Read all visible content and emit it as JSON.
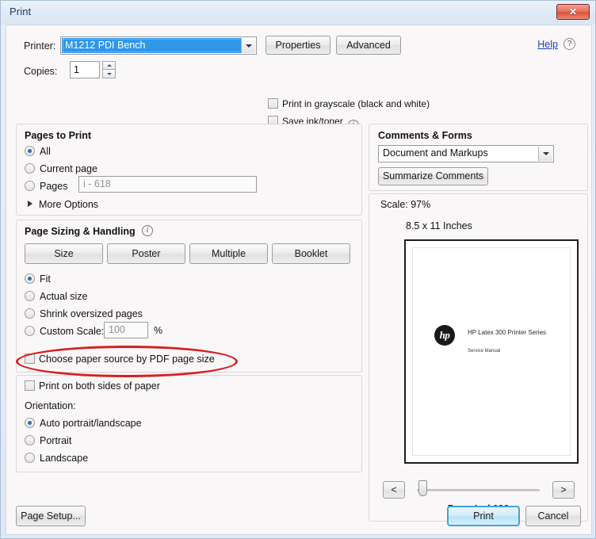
{
  "window": {
    "title": "Print",
    "close_label": "✕"
  },
  "printer": {
    "label": "Printer:",
    "selected": "M1212 PDI Bench",
    "properties_label": "Properties",
    "advanced_label": "Advanced",
    "help_label": "Help",
    "help_icon": "?",
    "copies_label": "Copies:",
    "copies_value": "1",
    "grayscale_label": "Print in grayscale (black and white)",
    "saveink_label": "Save ink/toner",
    "info_icon": "i"
  },
  "pages_to_print": {
    "header": "Pages to Print",
    "options": [
      {
        "label": "All",
        "selected": true
      },
      {
        "label": "Current page",
        "selected": false
      },
      {
        "label": "Pages",
        "selected": false
      }
    ],
    "pages_placeholder": "i - 618",
    "more_options_label": "More Options"
  },
  "page_sizing": {
    "header": "Page Sizing & Handling",
    "info_icon": "i",
    "buttons": [
      {
        "label": "Size"
      },
      {
        "label": "Poster"
      },
      {
        "label": "Multiple"
      },
      {
        "label": "Booklet"
      }
    ],
    "options": [
      {
        "label": "Fit",
        "selected": true
      },
      {
        "label": "Actual size",
        "selected": false
      },
      {
        "label": "Shrink oversized pages",
        "selected": false
      },
      {
        "label": "Custom Scale:",
        "selected": false
      }
    ],
    "custom_scale_value": "100",
    "percent_label": "%",
    "paper_source_label": "Choose paper source by PDF page size",
    "paper_source_checked": false
  },
  "sides_orientation": {
    "both_sides_label": "Print on both sides of paper",
    "both_sides_checked": false,
    "orientation_label": "Orientation:",
    "orientation_options": [
      {
        "label": "Auto portrait/landscape",
        "selected": true
      },
      {
        "label": "Portrait",
        "selected": false
      },
      {
        "label": "Landscape",
        "selected": false
      }
    ]
  },
  "comments_forms": {
    "header": "Comments & Forms",
    "selected": "Document and Markups",
    "summarize_label": "Summarize Comments"
  },
  "preview": {
    "scale_label": "Scale:  97%",
    "paper_size": "8.5 x 11 Inches",
    "doc_logo": "hp",
    "doc_title": "HP Latex 300 Printer Series",
    "doc_subtitle": "Service Manual",
    "prev_label": "<",
    "next_label": ">",
    "page_counter": "Page 1 of 628"
  },
  "footer": {
    "page_setup_label": "Page Setup...",
    "print_label": "Print",
    "cancel_label": "Cancel"
  },
  "annotation": {
    "color": "#d81f1f",
    "target": "Choose paper source by PDF page size"
  }
}
